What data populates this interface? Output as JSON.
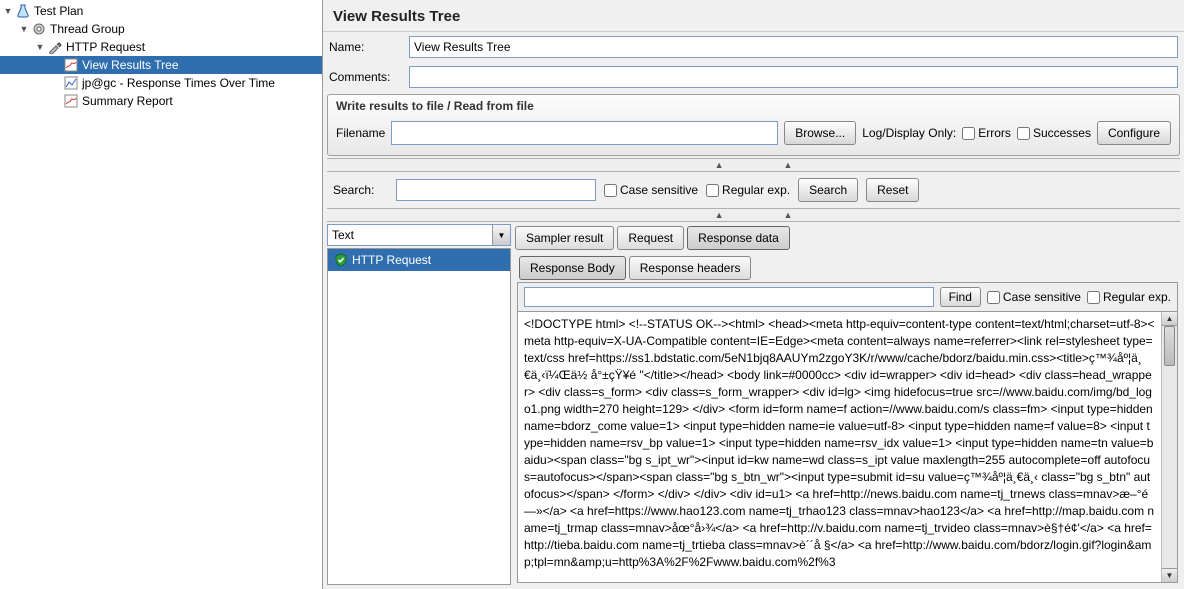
{
  "tree": {
    "test_plan": "Test Plan",
    "thread_group": "Thread Group",
    "http_request": "HTTP Request",
    "view_results_tree": "View Results Tree",
    "response_times": "jp@gc - Response Times Over Time",
    "summary_report": "Summary Report"
  },
  "header": {
    "title": "View Results Tree"
  },
  "form": {
    "name_label": "Name:",
    "name_value": "View Results Tree",
    "comments_label": "Comments:",
    "comments_value": ""
  },
  "file_section": {
    "title": "Write results to file / Read from file",
    "filename_label": "Filename",
    "filename_value": "",
    "browse": "Browse...",
    "logdisplay": "Log/Display Only:",
    "errors": "Errors",
    "successes": "Successes",
    "configure": "Configure"
  },
  "search": {
    "label": "Search:",
    "value": "",
    "case": "Case sensitive",
    "regex": "Regular exp.",
    "search_btn": "Search",
    "reset_btn": "Reset"
  },
  "renderer": {
    "selected": "Text"
  },
  "results": {
    "item0": "HTTP Request"
  },
  "tabs": {
    "sampler": "Sampler result",
    "request": "Request",
    "response_data": "Response data"
  },
  "subtabs": {
    "body": "Response Body",
    "headers": "Response headers"
  },
  "find": {
    "value": "",
    "btn": "Find",
    "case": "Case sensitive",
    "regex": "Regular exp."
  },
  "response_body": "<!DOCTYPE html>\n<!--STATUS OK--><html> <head><meta http-equiv=content-type content=text/html;charset=utf-8><meta http-equiv=X-UA-Compatible content=IE=Edge><meta content=always name=referrer><link rel=stylesheet type=text/css href=https://ss1.bdstatic.com/5eN1bjq8AAUYm2zgoY3K/r/www/cache/bdorz/baidu.min.css><title>ç™¾åº¦ä¸€ä¸‹ï¼Œä½ å°±çŸ¥é  \"</title></head> <body link=#0000cc> <div id=wrapper> <div id=head> <div class=head_wrapper> <div class=s_form> <div class=s_form_wrapper> <div id=lg> <img hidefocus=true src=//www.baidu.com/img/bd_logo1.png width=270 height=129> </div> <form id=form name=f action=//www.baidu.com/s class=fm> <input type=hidden name=bdorz_come value=1> <input type=hidden name=ie value=utf-8> <input type=hidden name=f value=8> <input type=hidden name=rsv_bp value=1> <input type=hidden name=rsv_idx value=1> <input type=hidden name=tn value=baidu><span class=\"bg s_ipt_wr\"><input id=kw name=wd class=s_ipt value maxlength=255 autocomplete=off autofocus=autofocus></span><span class=\"bg s_btn_wr\"><input type=submit id=su value=ç™¾åº¦ä¸€ä¸‹ class=\"bg s_btn\" autofocus></span> </form> </div> </div> <div id=u1> <a href=http://news.baidu.com name=tj_trnews class=mnav>æ–°é—»</a> <a href=https://www.hao123.com name=tj_trhao123 class=mnav>hao123</a> <a href=http://map.baidu.com name=tj_trmap class=mnav>åœ°å›¾</a> <a href=http://v.baidu.com name=tj_trvideo class=mnav>è§†é¢'</a> <a href=http://tieba.baidu.com name=tj_trtieba class=mnav>è´´å §</a> <a href=http://www.baidu.com/bdorz/login.gif?login&amp;tpl=mn&amp;u=http%3A%2F%2Fwww.baidu.com%2f%3"
}
